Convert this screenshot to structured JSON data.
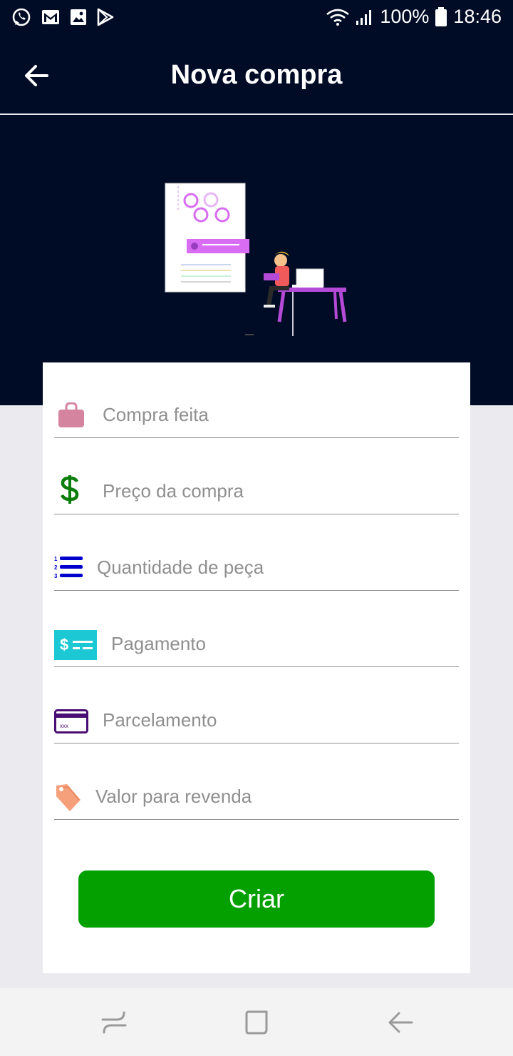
{
  "status_bar": {
    "icons": [
      "whatsapp-icon",
      "gmail-icon",
      "gallery-icon",
      "play-store-icon"
    ],
    "battery_percent": "100%",
    "time": "18:46"
  },
  "app_bar": {
    "title": "Nova compra"
  },
  "form": {
    "fields": [
      {
        "placeholder": "Compra feita",
        "icon": "shopping-bag-icon"
      },
      {
        "placeholder": "Preço da compra",
        "icon": "dollar-icon"
      },
      {
        "placeholder": "Quantidade de peça",
        "icon": "numbered-list-icon"
      },
      {
        "placeholder": "Pagamento",
        "icon": "payment-icon"
      },
      {
        "placeholder": "Parcelamento",
        "icon": "credit-card-icon"
      },
      {
        "placeholder": "Valor para revenda",
        "icon": "price-tag-icon"
      }
    ],
    "submit_label": "Criar"
  },
  "colors": {
    "header_bg": "#000c26",
    "primary_button": "#04a000",
    "bag_icon": "#d4849e",
    "dollar_icon": "#0a7d0a",
    "list_icon": "#0000cc",
    "payment_icon": "#1cc8d4",
    "card_icon": "#4a0d73",
    "tag_icon": "#f5a07a"
  }
}
